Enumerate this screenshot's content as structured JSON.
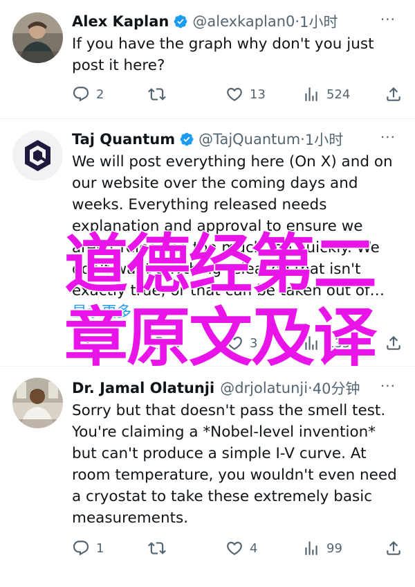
{
  "colors": {
    "text_primary": "#0f1419",
    "text_secondary": "#536471",
    "link": "#1d9bf0",
    "verified": "#1d9bf0",
    "overlay": "#e814e8"
  },
  "tweets": [
    {
      "name": "Alex Kaplan",
      "verified": true,
      "handle": "@alexkaplan0",
      "separator": "·",
      "time": "1小时",
      "text": "If you have the graph why don't you just post it here?",
      "more_icon": "more-dots",
      "actions": {
        "reply": "2",
        "retweet": "",
        "like": "13",
        "views": "524"
      }
    },
    {
      "name": "Taj Quantum",
      "verified": true,
      "handle": "@TajQuantum",
      "separator": "·",
      "time": "1小时",
      "text": "We will post everything here (On X) and on our website over the coming days and weeks. Everything released needs explanation and approval to ensure we aren't releasing too much too quickly. We don't want anything released that isn't exactly true, or that can be taken out of…",
      "show_more": "显示更多",
      "actions": {
        "reply": "",
        "retweet": "1",
        "like": "3",
        "views": "135"
      }
    },
    {
      "name": "Dr. Jamal Olatunji",
      "verified": false,
      "handle": "@drjolatunji",
      "separator": "·",
      "time": "40分钟",
      "text": "Sorry but that doesn't pass the smell test. You're claiming a *Nobel-level invention* but can't produce a simple I-V curve. At room temperature, you wouldn't even need a cryostat to take these extremely basic measurements.",
      "actions": {
        "reply": "1",
        "retweet": "",
        "like": "4",
        "views": "99"
      }
    }
  ],
  "overlay": {
    "line1": "道德经第二",
    "line2": "章原文及译"
  }
}
